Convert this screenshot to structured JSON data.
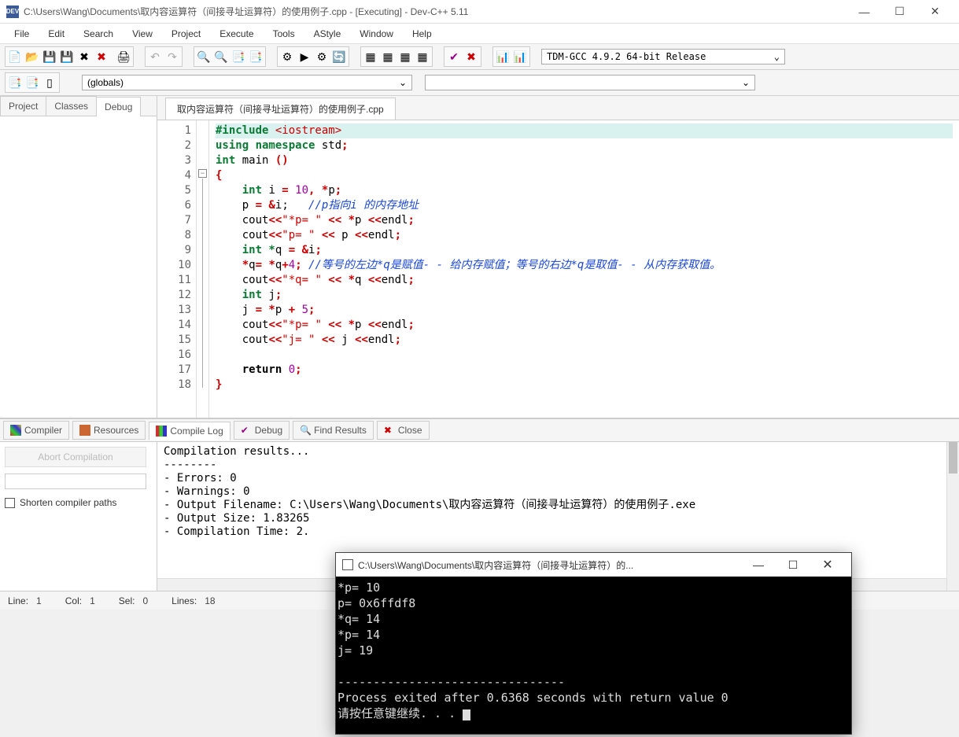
{
  "window": {
    "title": "C:\\Users\\Wang\\Documents\\取内容运算符（间接寻址运算符）的使用例子.cpp - [Executing] - Dev-C++ 5.11",
    "app_icon": "DEV"
  },
  "menu": [
    "File",
    "Edit",
    "Search",
    "View",
    "Project",
    "Execute",
    "Tools",
    "AStyle",
    "Window",
    "Help"
  ],
  "compiler_selector": "TDM-GCC 4.9.2 64-bit Release",
  "scope_selector": "(globals)",
  "left_tabs": [
    "Project",
    "Classes",
    "Debug"
  ],
  "left_active_tab": 2,
  "file_tab": "取内容运算符（间接寻址运算符）的使用例子.cpp",
  "code_lines": 18,
  "bottom_tabs": [
    {
      "icon": "grid",
      "label": "Compiler"
    },
    {
      "icon": "stack",
      "label": "Resources"
    },
    {
      "icon": "bars",
      "label": "Compile Log"
    },
    {
      "icon": "check",
      "label": "Debug"
    },
    {
      "icon": "search",
      "label": "Find Results"
    },
    {
      "icon": "close",
      "label": "Close"
    }
  ],
  "bottom_active_tab": 2,
  "abort_label": "Abort Compilation",
  "shorten_label": "Shorten compiler paths",
  "compile_log": "Compilation results...\n--------\n- Errors: 0\n- Warnings: 0\n- Output Filename: C:\\Users\\Wang\\Documents\\取内容运算符（间接寻址运算符）的使用例子.exe\n- Output Size: 1.83265\n- Compilation Time: 2.",
  "status": {
    "line_lbl": "Line:",
    "line_val": "1",
    "col_lbl": "Col:",
    "col_val": "1",
    "sel_lbl": "Sel:",
    "sel_val": "0",
    "lines_lbl": "Lines:",
    "lines_val": "18"
  },
  "console": {
    "title": "C:\\Users\\Wang\\Documents\\取内容运算符（间接寻址运算符）的...",
    "body": "*p= 10\np= 0x6ffdf8\n*q= 14\n*p= 14\nj= 19\n\n--------------------------------\nProcess exited after 0.6368 seconds with return value 0\n请按任意键继续. . . "
  },
  "code": {
    "l1_a": "#include ",
    "l1_b": "<iostream>",
    "l2_a": "using ",
    "l2_b": "namespace ",
    "l2_c": "std",
    "l3_a": "int ",
    "l3_b": "main ",
    "l5_a": "int ",
    "l5_b": "i ",
    "l5_c": "= ",
    "l5_d": "10",
    "l5_e": ", *",
    "l5_f": "p",
    "l6_a": "p ",
    "l6_b": "= &",
    "l6_c": "i",
    "l6_d": ";   ",
    "l6_cm": "//p指向i 的内存地址",
    "l7_a": "cout",
    "l7_b": "<<",
    "l7_c": "\"*p= \"",
    "l7_d": " << *",
    "l7_e": "p ",
    "l7_f": "<<",
    "l7_g": "endl",
    "l8_c": "\"p= \"",
    "l8_e": "p ",
    "l9_a": "int *",
    "l9_b": "q ",
    "l9_c": "= &",
    "l9_d": "i",
    "l10_a": "*",
    "l10_b": "q",
    "l10_c": "= *",
    "l10_d": "q",
    "l10_e": "+",
    "l10_f": "4",
    "l10_g": "; ",
    "l10_cm": "//等号的左边*q是赋值- - 给内存赋值；等号的右边*q是取值- - 从内存获取值。",
    "l11_c": "\"*q= \"",
    "l11_e": "q ",
    "l12_a": "int ",
    "l12_b": "j",
    "l13_a": "j ",
    "l13_b": "= *",
    "l13_c": "p ",
    "l13_d": "+ ",
    "l13_e": "5",
    "l15_c": "\"j= \"",
    "l15_d": " << ",
    "l15_e": "j ",
    "l17_a": "return ",
    "l17_b": "0"
  }
}
